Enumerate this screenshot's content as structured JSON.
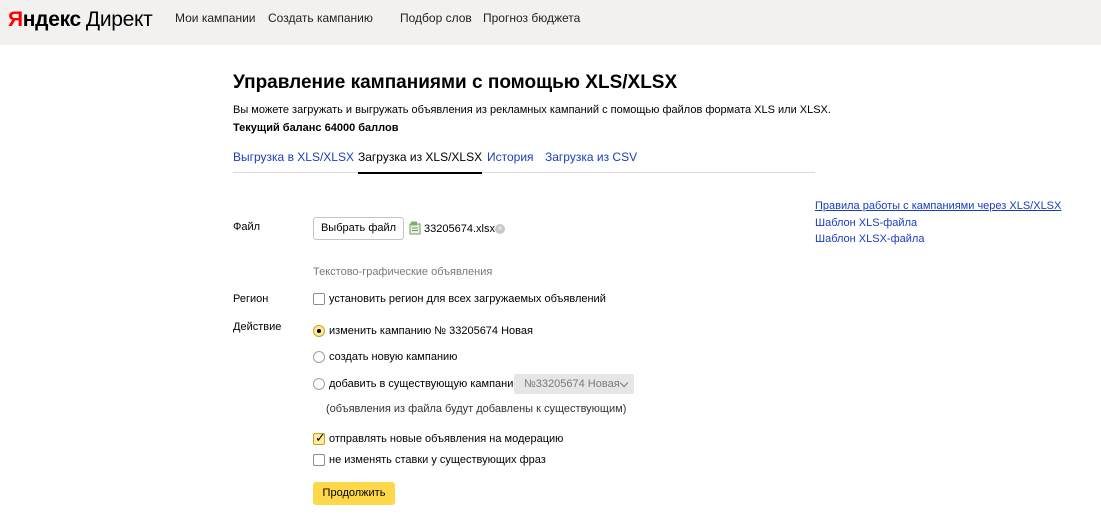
{
  "header": {
    "logo": {
      "ya": "Я",
      "ndex": "ндекс",
      "direct": "Директ"
    },
    "nav": [
      "Мои кампании",
      "Создать кампанию",
      "Подбор слов",
      "Прогноз бюджета"
    ]
  },
  "page": {
    "title": "Управление кампаниями с помощью XLS/XLSX",
    "description": "Вы можете загружать и выгружать объявления из рекламных кампаний с помощью файлов формата XLS или XLSX.",
    "balance": "Текущий баланс 64000 баллов"
  },
  "tabs": [
    {
      "label": "Выгрузка в XLS/XLSX",
      "active": false
    },
    {
      "label": "Загрузка из XLS/XLSX",
      "active": true
    },
    {
      "label": "История",
      "active": false
    },
    {
      "label": "Загрузка из CSV",
      "active": false
    }
  ],
  "form": {
    "file_label": "Файл",
    "choose_file_button": "Выбрать файл",
    "file_name": "33205674.xlsx",
    "clear_glyph": "×",
    "section_title": "Текстово-графические объявления",
    "region_label": "Регион",
    "region_checkbox": {
      "label": "установить регион для всех загружаемых объявлений",
      "checked": false
    },
    "action_label": "Действие",
    "actions": [
      {
        "label": "изменить кампанию № 33205674 Новая",
        "checked": true
      },
      {
        "label": "создать новую кампанию",
        "checked": false
      },
      {
        "label": "добавить в существующую кампанию",
        "checked": false
      }
    ],
    "campaign_select": {
      "value": "№33205674 Новая"
    },
    "add_note": "(объявления из файла будут добавлены к существующим)",
    "moderation_checkbox": {
      "label": "отправлять новые объявления на модерацию",
      "checked": true
    },
    "keep_bids_checkbox": {
      "label": "не изменять ставки у существующих фраз",
      "checked": false
    },
    "continue_button": "Продолжить"
  },
  "side_links": [
    "Правила работы с кампаниями через XLS/XLSX",
    "Шаблон XLS-файла",
    "Шаблон XLSX-файла"
  ],
  "colors": {
    "link": "#1a3dc1",
    "accent": "#ffd84a",
    "topbar": "#f2f1f0"
  }
}
